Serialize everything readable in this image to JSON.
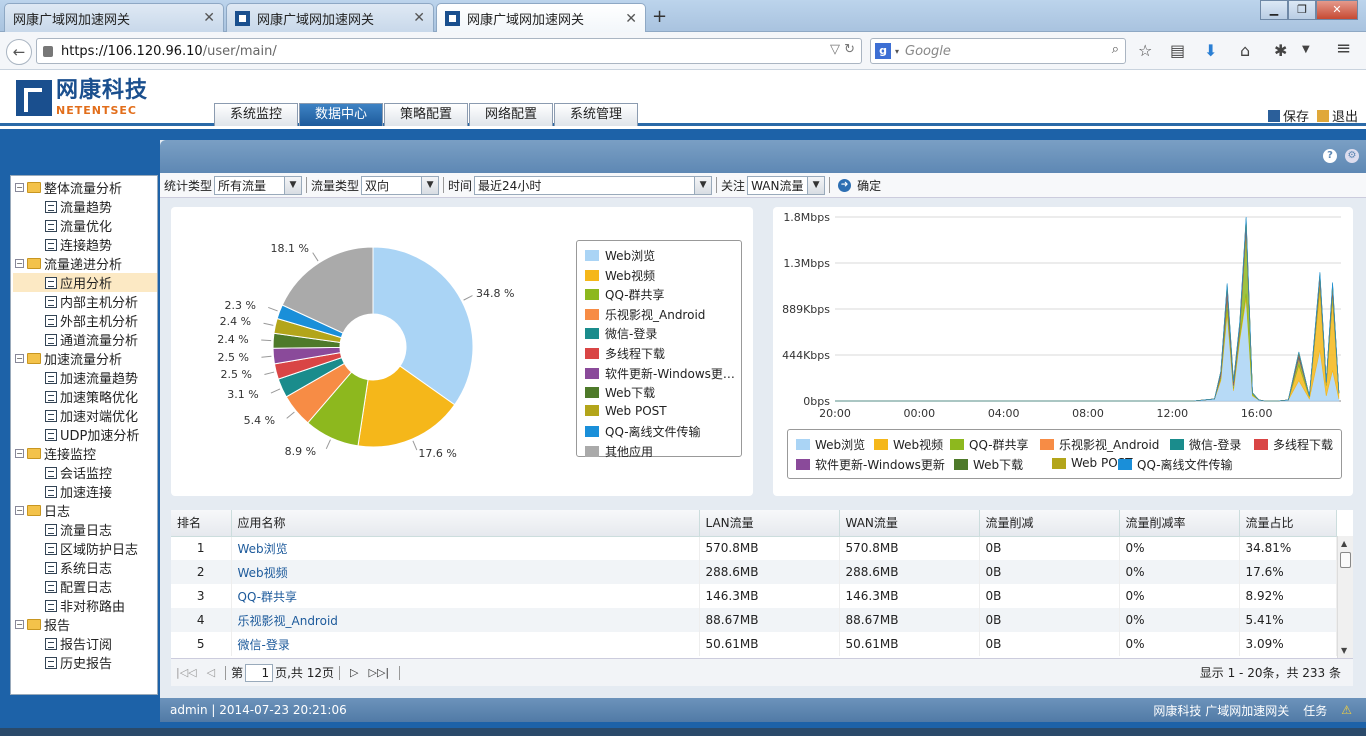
{
  "browser": {
    "tabs": [
      {
        "title": "网康广域网加速网关"
      },
      {
        "title": "网康广域网加速网关"
      },
      {
        "title": "网康广域网加速网关"
      }
    ],
    "url_host": "https://106.120.96.10",
    "url_path": "/user/main/",
    "search_placeholder": "Google",
    "search_engine_letter": "g"
  },
  "app": {
    "logo_cn": "网康科技",
    "logo_en": "NETENTSEC",
    "tabs": [
      "系统监控",
      "数据中心",
      "策略配置",
      "网络配置",
      "系统管理"
    ],
    "active_tab": 1,
    "save_label": "保存",
    "logout_label": "退出"
  },
  "sidebar": {
    "groups": [
      {
        "label": "整体流量分析",
        "items": [
          "流量趋势",
          "流量优化",
          "连接趋势"
        ]
      },
      {
        "label": "流量递进分析",
        "items": [
          "应用分析",
          "内部主机分析",
          "外部主机分析",
          "通道流量分析"
        ]
      },
      {
        "label": "加速流量分析",
        "items": [
          "加速流量趋势",
          "加速策略优化",
          "加速对端优化",
          "UDP加速分析"
        ]
      },
      {
        "label": "连接监控",
        "items": [
          "会话监控",
          "加速连接"
        ]
      },
      {
        "label": "日志",
        "items": [
          "流量日志",
          "区域防护日志",
          "系统日志",
          "配置日志",
          "非对称路由"
        ]
      },
      {
        "label": "报告",
        "items": [
          "报告订阅",
          "历史报告"
        ]
      }
    ],
    "selected": "应用分析"
  },
  "filters": {
    "stat_type_label": "统计类型",
    "stat_type_value": "所有流量",
    "flow_type_label": "流量类型",
    "flow_type_value": "双向",
    "time_label": "时间",
    "time_value": "最近24小时",
    "focus_label": "关注",
    "focus_value": "WAN流量",
    "confirm_label": "确定"
  },
  "colors": {
    "web_browse": "#aad4f5",
    "web_video": "#f5b71a",
    "qq_group": "#8db81e",
    "letv": "#f78c45",
    "wechat": "#1a8c8c",
    "multithread": "#d94545",
    "software_update": "#8a4a9a",
    "web_download": "#4e7a2a",
    "web_post": "#b3a51a",
    "qq_offline": "#1a8fd9",
    "other": "#aaaaaa",
    "accent": "#1d62a8"
  },
  "chart_data": [
    {
      "type": "pie",
      "donut": true,
      "labels": [
        "Web浏览",
        "Web视频",
        "QQ-群共享",
        "乐视影视_Android",
        "微信-登录",
        "多线程下载",
        "软件更新-Windows更新",
        "Web下载",
        "Web POST",
        "QQ-离线文件传输",
        "其他应用"
      ],
      "legend_labels": [
        "Web浏览",
        "Web视频",
        "QQ-群共享",
        "乐视影视_Android",
        "微信-登录",
        "多线程下载",
        "软件更新-Windows更…",
        "Web下载",
        "Web POST",
        "QQ-离线文件传输",
        "其他应用"
      ],
      "values": [
        34.8,
        17.6,
        8.9,
        5.4,
        3.1,
        2.5,
        2.5,
        2.4,
        2.4,
        2.3,
        18.1
      ],
      "value_labels": [
        "34.8 %",
        "17.6 %",
        "8.9 %",
        "5.4 %",
        "3.1 %",
        "2.5 %",
        "2.5 %",
        "2.4 %",
        "2.4 %",
        "2.3 %",
        "18.1 %"
      ],
      "colors": [
        "#aad4f5",
        "#f5b71a",
        "#8db81e",
        "#f78c45",
        "#1a8c8c",
        "#d94545",
        "#8a4a9a",
        "#4e7a2a",
        "#b3a51a",
        "#1a8fd9",
        "#aaaaaa"
      ],
      "legend_placement": "right"
    },
    {
      "type": "area",
      "stacked": true,
      "y_ticks": [
        "0bps",
        "444Kbps",
        "889Kbps",
        "1.3Mbps",
        "1.8Mbps"
      ],
      "x_ticks": [
        "20:00",
        "00:00",
        "04:00",
        "08:00",
        "12:00",
        "16:00"
      ],
      "ylim_mbps": [
        0,
        1.8
      ],
      "x_hours": [
        0,
        2,
        4,
        6,
        8,
        10,
        12,
        14,
        16,
        17,
        17.5,
        18,
        18.3,
        18.6,
        18.9,
        19.2,
        19.5,
        19.8,
        20.1,
        20.4,
        20.7,
        21,
        21.5,
        22,
        22.5,
        23,
        23.3,
        23.6,
        23.9
      ],
      "series": [
        {
          "name": "Web浏览",
          "values": [
            0,
            0,
            0,
            0,
            0,
            0,
            0,
            0,
            0,
            0,
            0.01,
            0.02,
            0.2,
            0.85,
            0.1,
            0.6,
            1.0,
            0.05,
            0.01,
            0,
            0,
            0,
            0.01,
            0.2,
            0.02,
            0.5,
            0.05,
            0.3,
            0.02
          ]
        },
        {
          "name": "Web视频",
          "values": [
            0,
            0,
            0,
            0,
            0,
            0,
            0,
            0,
            0,
            0,
            0,
            0,
            0.02,
            0.05,
            0.02,
            0.03,
            0.05,
            0.01,
            0,
            0,
            0,
            0,
            0,
            0.15,
            0.02,
            0.6,
            0.1,
            0.7,
            0.05
          ]
        },
        {
          "name": "QQ-群共享",
          "values": [
            0,
            0,
            0,
            0,
            0,
            0,
            0,
            0,
            0,
            0,
            0,
            0,
            0.02,
            0.1,
            0.02,
            0.05,
            0.6,
            0.02,
            0,
            0,
            0,
            0,
            0,
            0.05,
            0.01,
            0.05,
            0.02,
            0.05,
            0.01
          ]
        },
        {
          "name": "乐视影视_Android",
          "values": [
            0,
            0,
            0,
            0,
            0,
            0,
            0,
            0,
            0,
            0,
            0,
            0,
            0.01,
            0.02,
            0.01,
            0.02,
            0.03,
            0,
            0,
            0,
            0,
            0,
            0,
            0.02,
            0,
            0.03,
            0.01,
            0.03,
            0
          ]
        },
        {
          "name": "微信-登录",
          "values": [
            0,
            0,
            0,
            0,
            0,
            0,
            0,
            0,
            0,
            0,
            0,
            0,
            0.01,
            0.03,
            0.01,
            0.02,
            0.03,
            0,
            0,
            0,
            0,
            0,
            0,
            0.02,
            0,
            0.02,
            0.01,
            0.02,
            0
          ]
        },
        {
          "name": "多线程下载",
          "values": [
            0,
            0,
            0,
            0,
            0,
            0,
            0,
            0,
            0,
            0,
            0,
            0,
            0.01,
            0.04,
            0.01,
            0.02,
            0.03,
            0,
            0,
            0,
            0,
            0,
            0,
            0.01,
            0,
            0.02,
            0,
            0.02,
            0
          ]
        },
        {
          "name": "软件更新-Windows更新",
          "values": [
            0,
            0,
            0,
            0,
            0,
            0,
            0,
            0,
            0,
            0,
            0,
            0,
            0.01,
            0.02,
            0.01,
            0.01,
            0.02,
            0,
            0,
            0,
            0,
            0,
            0,
            0.01,
            0,
            0.01,
            0,
            0.01,
            0
          ]
        },
        {
          "name": "Web下载",
          "values": [
            0,
            0,
            0,
            0,
            0,
            0,
            0,
            0,
            0,
            0,
            0,
            0,
            0.01,
            0.02,
            0.01,
            0.01,
            0.02,
            0,
            0,
            0,
            0,
            0,
            0,
            0.01,
            0,
            0.01,
            0,
            0.01,
            0
          ]
        },
        {
          "name": "Web POST",
          "values": [
            0,
            0,
            0,
            0,
            0,
            0,
            0,
            0,
            0,
            0,
            0,
            0,
            0,
            0.01,
            0,
            0.01,
            0.01,
            0,
            0,
            0,
            0,
            0,
            0,
            0.01,
            0,
            0.01,
            0,
            0.01,
            0
          ]
        },
        {
          "name": "QQ-离线文件传输",
          "values": [
            0,
            0,
            0,
            0,
            0,
            0,
            0,
            0,
            0,
            0,
            0,
            0,
            0,
            0.01,
            0,
            0.01,
            0.01,
            0,
            0,
            0,
            0,
            0,
            0,
            0,
            0,
            0.01,
            0,
            0.01,
            0
          ]
        }
      ],
      "legend_placement": "bottom",
      "grid": true
    }
  ],
  "table": {
    "columns": [
      "排名",
      "应用名称",
      "LAN流量",
      "WAN流量",
      "流量削减",
      "流量削减率",
      "流量占比"
    ],
    "rows": [
      [
        "1",
        "Web浏览",
        "570.8MB",
        "570.8MB",
        "0B",
        "0%",
        "34.81%"
      ],
      [
        "2",
        "Web视频",
        "288.6MB",
        "288.6MB",
        "0B",
        "0%",
        "17.6%"
      ],
      [
        "3",
        "QQ-群共享",
        "146.3MB",
        "146.3MB",
        "0B",
        "0%",
        "8.92%"
      ],
      [
        "4",
        "乐视影视_Android",
        "88.67MB",
        "88.67MB",
        "0B",
        "0%",
        "5.41%"
      ],
      [
        "5",
        "微信-登录",
        "50.61MB",
        "50.61MB",
        "0B",
        "0%",
        "3.09%"
      ]
    ]
  },
  "pager": {
    "page_prefix": "第",
    "current_page": "1",
    "page_suffix": "页,共 12页",
    "summary": "显示 1 - 20条，共 233 条"
  },
  "footer": {
    "user_time": "admin | 2014-07-23 20:21:06",
    "product": "网康科技 广域网加速网关",
    "task_label": "任务"
  }
}
